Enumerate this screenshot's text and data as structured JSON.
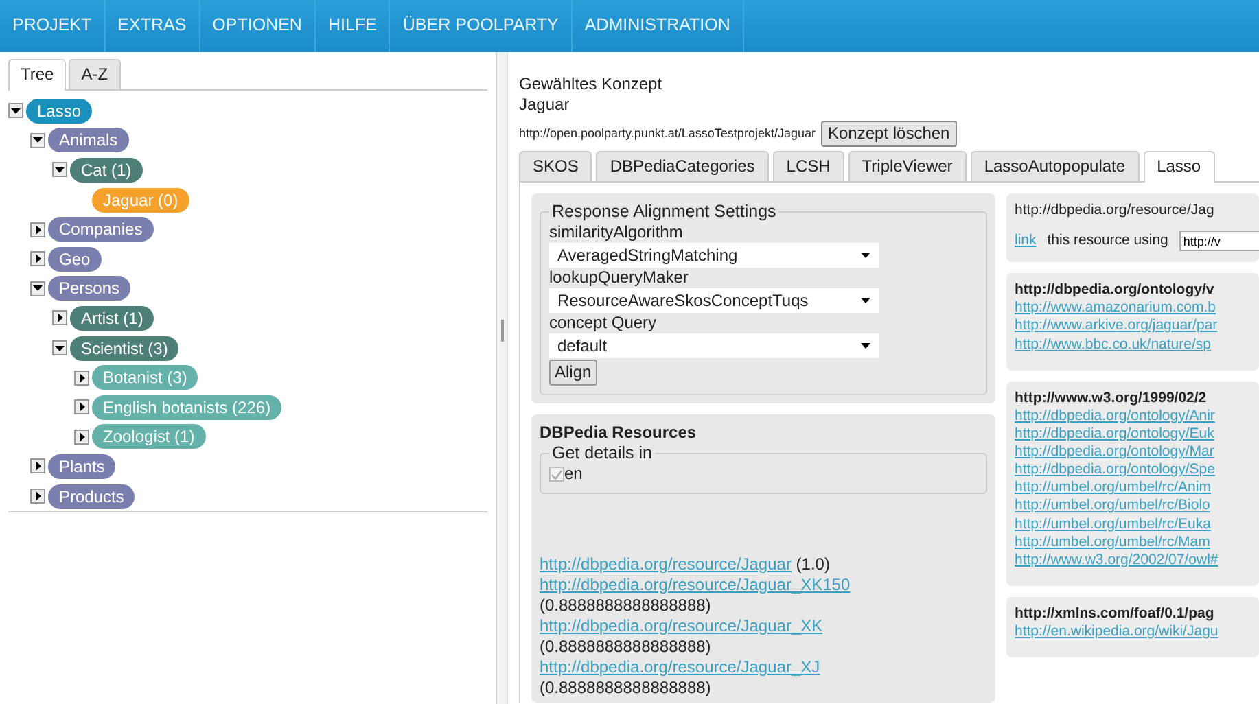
{
  "menu": [
    {
      "label": "PROJEKT"
    },
    {
      "label": "EXTRAS"
    },
    {
      "label": "OPTIONEN"
    },
    {
      "label": "HILFE"
    },
    {
      "label": "ÜBER POOLPARTY"
    },
    {
      "label": "ADMINISTRATION"
    }
  ],
  "left_tabs": [
    {
      "label": "Tree",
      "selected": true
    },
    {
      "label": "A-Z",
      "selected": false
    }
  ],
  "tree": [
    {
      "label": "Lasso",
      "selected": false,
      "expanded": true,
      "children": [
        {
          "label": "Animals",
          "selected": false,
          "expanded": true,
          "children": [
            {
              "label": "Cat (1)",
              "selected": false,
              "expanded": true,
              "children": [
                {
                  "label": "Jaguar (0)",
                  "selected": true
                }
              ]
            }
          ]
        },
        {
          "label": "Companies",
          "selected": false,
          "expanded": false
        },
        {
          "label": "Geo",
          "selected": false,
          "expanded": false
        },
        {
          "label": "Persons",
          "selected": false,
          "expanded": true,
          "children": [
            {
              "label": "Artist (1)",
              "selected": false,
              "expanded": false
            },
            {
              "label": "Scientist (3)",
              "selected": false,
              "expanded": true,
              "children": [
                {
                  "label": "Botanist (3)",
                  "selected": false,
                  "expanded": false
                },
                {
                  "label": "English botanists (226)",
                  "selected": false,
                  "expanded": false
                },
                {
                  "label": "Zoologist (1)",
                  "selected": false,
                  "expanded": false
                }
              ]
            }
          ]
        },
        {
          "label": "Plants",
          "selected": false,
          "expanded": false
        },
        {
          "label": "Products",
          "selected": false,
          "expanded": false
        }
      ]
    }
  ],
  "concept": {
    "heading": "Gewähltes Konzept",
    "name": "Jaguar",
    "uri": "http://open.poolparty.punkt.at/LassoTestprojekt/Jaguar",
    "delete_button": "Konzept löschen"
  },
  "tabs": [
    {
      "label": "SKOS",
      "selected": false
    },
    {
      "label": "DBPediaCategories",
      "selected": false
    },
    {
      "label": "LCSH",
      "selected": false
    },
    {
      "label": "TripleViewer",
      "selected": false
    },
    {
      "label": "LassoAutopopulate",
      "selected": false
    },
    {
      "label": "Lasso",
      "selected": true
    }
  ],
  "settings": {
    "legend": "Response Alignment Settings",
    "fields": [
      {
        "label": "similarityAlgorithm",
        "value": "AveragedStringMatching"
      },
      {
        "label": "lookupQueryMaker",
        "value": "ResourceAwareSkosConceptTuqs"
      },
      {
        "label": "concept Query",
        "value": "default"
      }
    ],
    "button": "Align"
  },
  "dbpedia": {
    "title": "DBPedia Resources",
    "legend": "Get details in",
    "languages": [
      {
        "label": "en",
        "checked": true,
        "disabled": true
      }
    ],
    "results": [
      {
        "link": "http://dbpedia.org/resource/Jaguar",
        "score": "(1.0)"
      },
      {
        "link": "http://dbpedia.org/resource/Jaguar_XK150",
        "score": "(0.8888888888888888)"
      },
      {
        "link": "http://dbpedia.org/resource/Jaguar_XK",
        "score": "(0.8888888888888888)"
      },
      {
        "link": "http://dbpedia.org/resource/Jaguar_XJ",
        "score": "(0.8888888888888888)"
      }
    ]
  },
  "resource_card": {
    "uri": "http://dbpedia.org/resource/Jag",
    "link": "link",
    "text": "this resource using",
    "input_value": "http://v"
  },
  "property_cards": [
    {
      "title": "http://dbpedia.org/ontology/v",
      "links": [
        "http://www.amazonarium.com.b",
        "http://www.arkive.org/jaguar/par",
        "http://www.bbc.co.uk/nature/sp"
      ]
    },
    {
      "title": "http://www.w3.org/1999/02/2",
      "links": [
        "http://dbpedia.org/ontology/Anir",
        "http://dbpedia.org/ontology/Euk",
        "http://dbpedia.org/ontology/Mar",
        "http://dbpedia.org/ontology/Spe",
        "http://umbel.org/umbel/rc/Anim",
        "http://umbel.org/umbel/rc/Biolo",
        "http://umbel.org/umbel/rc/Euka",
        "http://umbel.org/umbel/rc/Mam",
        "http://www.w3.org/2002/07/owl#"
      ]
    },
    {
      "title": "http://xmlns.com/foaf/0.1/pag",
      "links": [
        "http://en.wikipedia.org/wiki/Jagu"
      ]
    }
  ]
}
